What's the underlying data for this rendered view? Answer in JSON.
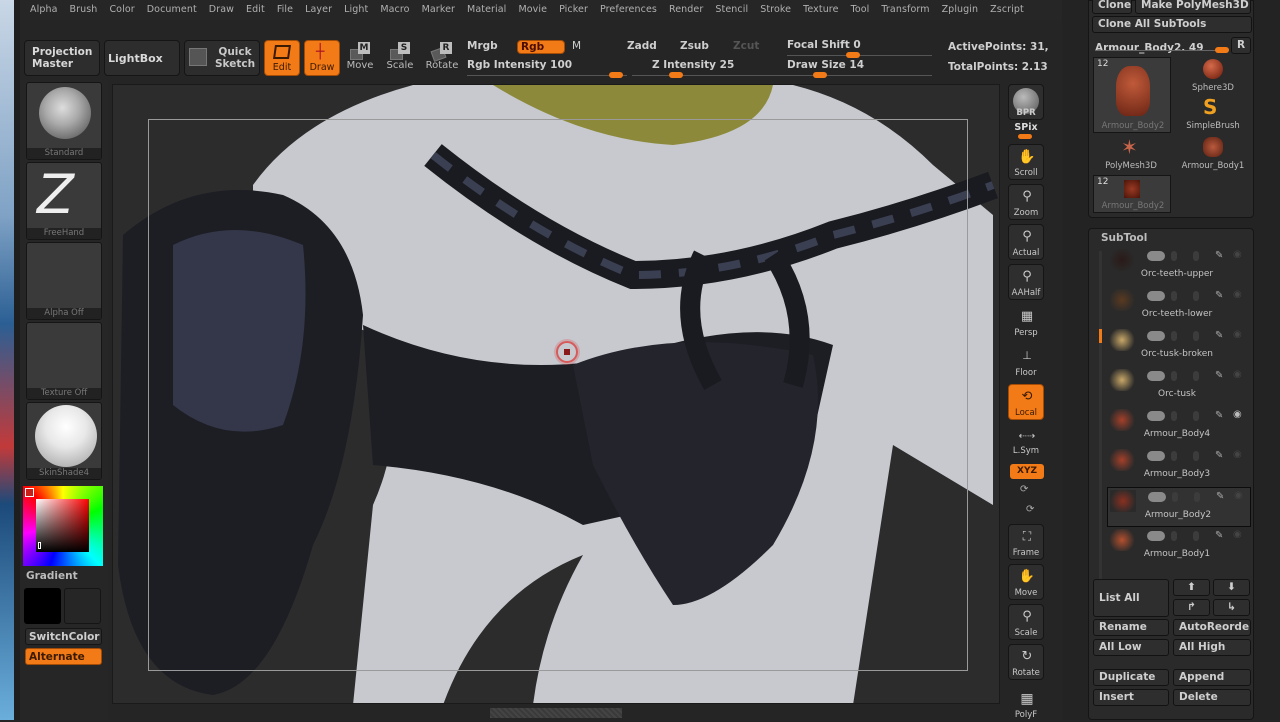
{
  "menubar": {
    "items": [
      "Alpha",
      "Brush",
      "Color",
      "Document",
      "Draw",
      "Edit",
      "File",
      "Layer",
      "Light",
      "Macro",
      "Marker",
      "Material",
      "Movie",
      "Picker",
      "Preferences",
      "Render",
      "Stencil",
      "Stroke",
      "Texture",
      "Tool",
      "Transform",
      "Zplugin",
      "Zscript"
    ]
  },
  "toolbar": {
    "projection_master": "Projection Master",
    "lightbox": "LightBox",
    "quick_sketch": "Quick Sketch",
    "edit": "Edit",
    "draw": "Draw",
    "move": "Move",
    "scale": "Scale",
    "rotate": "Rotate",
    "move_key": "M",
    "scale_key": "S",
    "rotate_key": "R",
    "mrgb": "Mrgb",
    "rgb": "Rgb",
    "m": "M",
    "zadd": "Zadd",
    "zsub": "Zsub",
    "zcut": "Zcut",
    "rgb_intensity_label": "Rgb Intensity",
    "rgb_intensity": "100",
    "z_intensity_label": "Z Intensity",
    "z_intensity": "25",
    "focal_shift_label": "Focal Shift",
    "focal_shift": "0",
    "draw_size_label": "Draw Size",
    "draw_size": "14",
    "active_points": "ActivePoints: 31,",
    "total_points": "TotalPoints: 2.13",
    "sliders": {
      "rgb_intensity_fraction": 1.0,
      "z_intensity_fraction": 0.25,
      "focal_shift_fraction": 0.5,
      "draw_size_fraction": 0.05
    }
  },
  "left_shelf": {
    "brush": "Standard",
    "stroke": "FreeHand",
    "alpha": "Alpha Off",
    "texture": "Texture Off",
    "material": "SkinShade4",
    "gradient": "Gradient",
    "switch_color": "SwitchColor",
    "alternate": "Alternate",
    "main_color": "#c8201a",
    "secondary_color": "#000000"
  },
  "right_shelf": {
    "items": [
      "BPR",
      "SPix",
      "Scroll",
      "Zoom",
      "Actual",
      "AAHalf",
      "Persp",
      "Floor",
      "Local",
      "L.Sym",
      "XYZ",
      "Frame",
      "Move",
      "Scale",
      "Rotate",
      "PolyF"
    ]
  },
  "tool_panel": {
    "clone": "Clone",
    "make_polymesh": "Make PolyMesh3D",
    "clone_all": "Clone All SubTools",
    "current_tool": "Armour_Body2. 49",
    "r_button": "R",
    "tools": [
      {
        "name": "Armour_Body2",
        "count": "12"
      },
      {
        "name": "Sphere3D"
      },
      {
        "name": "SimpleBrush"
      },
      {
        "name": "PolyMesh3D"
      },
      {
        "name": "Armour_Body1"
      },
      {
        "name": "Armour_Body2",
        "count": "12"
      }
    ]
  },
  "subtool_panel": {
    "title": "SubTool",
    "items": [
      {
        "name": "Orc-teeth-upper",
        "selected": false,
        "visible": false
      },
      {
        "name": "Orc-teeth-lower",
        "selected": false,
        "visible": false
      },
      {
        "name": "Orc-tusk-broken",
        "selected": false,
        "visible": false
      },
      {
        "name": "Orc-tusk",
        "selected": false,
        "visible": false
      },
      {
        "name": "Armour_Body4",
        "selected": false,
        "visible": true
      },
      {
        "name": "Armour_Body3",
        "selected": false,
        "visible": false
      },
      {
        "name": "Armour_Body2",
        "selected": true,
        "visible": false
      },
      {
        "name": "Armour_Body1",
        "selected": false,
        "visible": false
      }
    ],
    "list_all": "List All",
    "rename": "Rename",
    "auto_reorder": "AutoReorder",
    "all_low": "All Low",
    "all_high": "All High",
    "duplicate": "Duplicate",
    "append": "Append",
    "insert": "Insert",
    "delete": "Delete"
  },
  "colors": {
    "accent": "#f27a17",
    "panel": "#2a2a2a",
    "background": "#252525"
  }
}
